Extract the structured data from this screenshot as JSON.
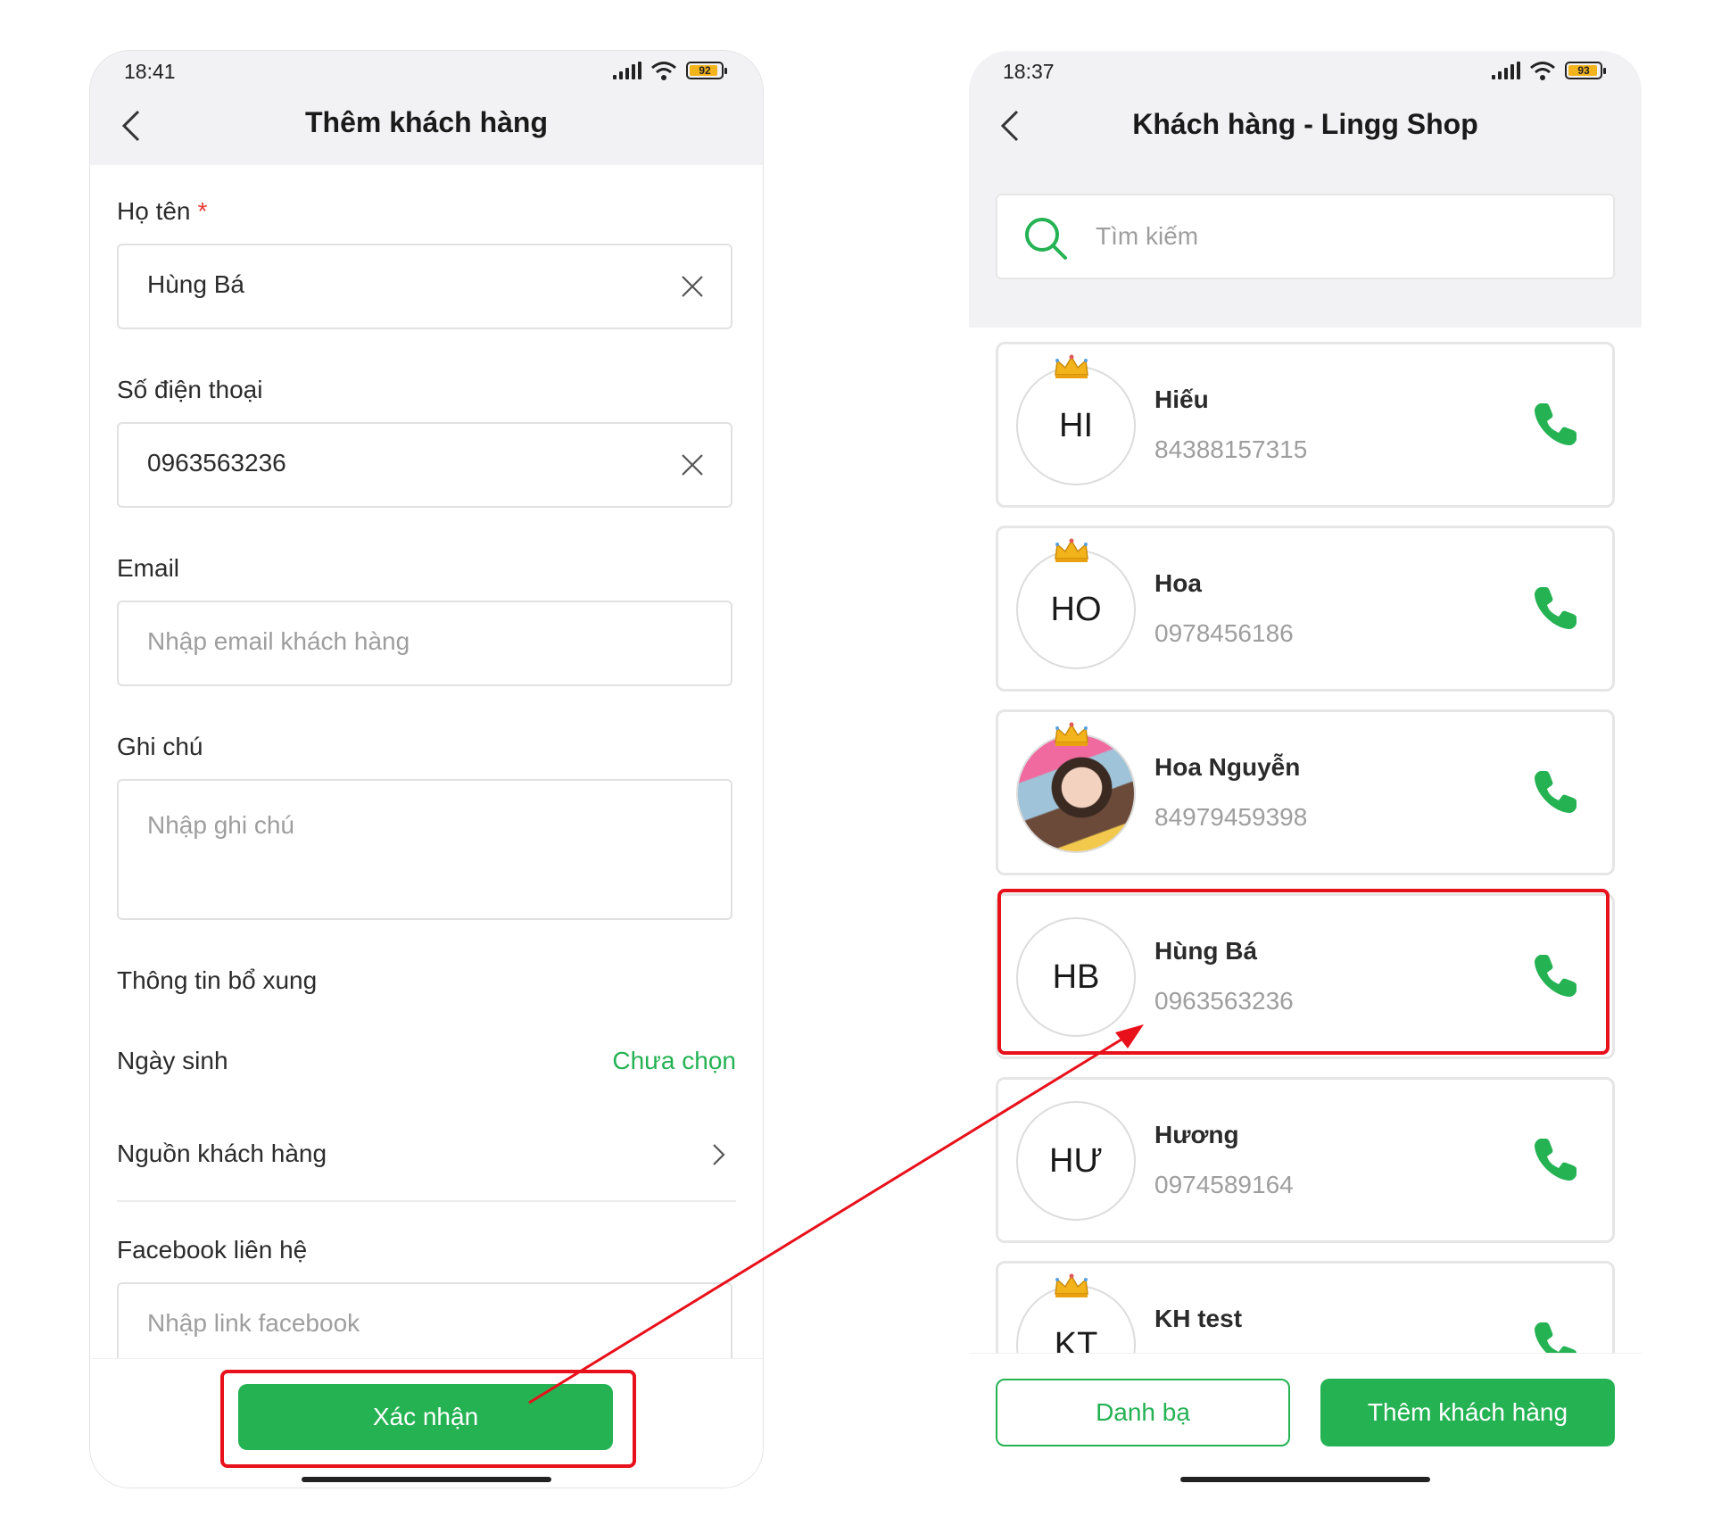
{
  "left_screen": {
    "status": {
      "time": "18:41",
      "battery": "92",
      "battery_level": 0.92
    },
    "title": "Thêm khách hàng",
    "fields": {
      "name": {
        "label": "Họ tên",
        "required_mark": "*",
        "value": "Hùng Bá"
      },
      "phone": {
        "label": "Số điện thoại",
        "value": "0963563236"
      },
      "email": {
        "label": "Email",
        "placeholder": "Nhập email khách hàng"
      },
      "note": {
        "label": "Ghi chú",
        "placeholder": "Nhập ghi chú"
      }
    },
    "extra_section": "Thông tin bổ xung",
    "birthday": {
      "label": "Ngày sinh",
      "value": "Chưa chọn"
    },
    "source": {
      "label": "Nguồn khách hàng"
    },
    "facebook": {
      "label": "Facebook liên hệ",
      "placeholder": "Nhập link facebook"
    },
    "confirm_button": "Xác nhận"
  },
  "right_screen": {
    "status": {
      "time": "18:37",
      "battery": "93",
      "battery_level": 0.93
    },
    "title": "Khách hàng - Lingg Shop",
    "search_placeholder": "Tìm kiếm",
    "customers": [
      {
        "initials": "HI",
        "name": "Hiếu",
        "phone": "84388157315",
        "vip": true,
        "photo": false
      },
      {
        "initials": "HO",
        "name": "Hoa",
        "phone": "0978456186",
        "vip": true,
        "photo": false
      },
      {
        "initials": "",
        "name": "Hoa Nguyễn",
        "phone": "84979459398",
        "vip": true,
        "photo": true
      },
      {
        "initials": "HB",
        "name": "Hùng Bá",
        "phone": "0963563236",
        "vip": false,
        "photo": false
      },
      {
        "initials": "HƯ",
        "name": "Hương",
        "phone": "0974589164",
        "vip": false,
        "photo": false
      },
      {
        "initials": "KT",
        "name": "KH test",
        "phone": "",
        "vip": true,
        "photo": false
      }
    ],
    "contacts_button": "Danh bạ",
    "add_button": "Thêm khách hàng"
  },
  "colors": {
    "accent": "#24b253",
    "highlight": "#e8101a",
    "required": "#e53935"
  },
  "icons": [
    "back-arrow-icon",
    "clear-icon",
    "chevron-right-icon",
    "search-icon",
    "phone-call-icon",
    "crown-icon",
    "signal-icon",
    "wifi-icon",
    "battery-icon"
  ]
}
